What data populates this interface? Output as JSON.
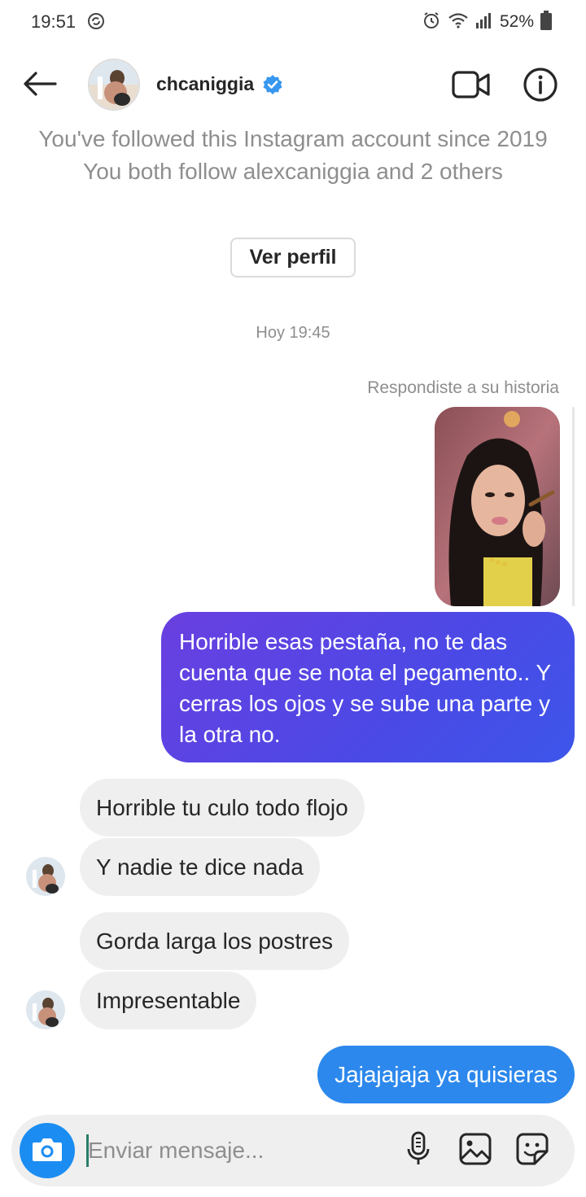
{
  "status_bar": {
    "time": "19:51",
    "battery": "52%",
    "icons": [
      "sync-icon",
      "alarm-icon",
      "wifi-icon",
      "signal-icon",
      "battery-icon"
    ]
  },
  "header": {
    "username": "chcaniggia",
    "verified": true,
    "icons": [
      "back-arrow-icon",
      "video-call-icon",
      "info-icon",
      "verified-badge-icon"
    ]
  },
  "follow_info": {
    "line1": "You've followed this Instagram account since 2019",
    "line2": "You both follow alexcaniggia and 2 others"
  },
  "view_profile_label": "Ver perfil",
  "timestamp": "Hoy 19:45",
  "story_reply_label": "Respondiste a su historia",
  "messages": [
    {
      "from": "me",
      "text": "Horrible esas pestaña,  no te das cuenta que se nota el pegamento.. Y cerras los ojos y se sube una parte y la otra no."
    },
    {
      "from": "them",
      "text": "Horrible tu culo todo flojo"
    },
    {
      "from": "them",
      "text": "Y nadie te dice nada"
    },
    {
      "from": "them",
      "text": "Gorda larga  los postres"
    },
    {
      "from": "them",
      "text": "Impresentable"
    },
    {
      "from": "me",
      "text": "Jajajajaja ya quisieras"
    }
  ],
  "composer": {
    "placeholder": "Enviar mensaje...",
    "icons": [
      "camera-icon",
      "microphone-icon",
      "gallery-icon",
      "sticker-icon"
    ]
  },
  "colors": {
    "sent_gradient_start": "#6a3fe0",
    "sent_gradient_end": "#3d56ea",
    "sent_blue": "#2c88ec",
    "received_bg": "#efefef",
    "camera_blue": "#1b8df2",
    "verified_blue": "#3897f0"
  }
}
